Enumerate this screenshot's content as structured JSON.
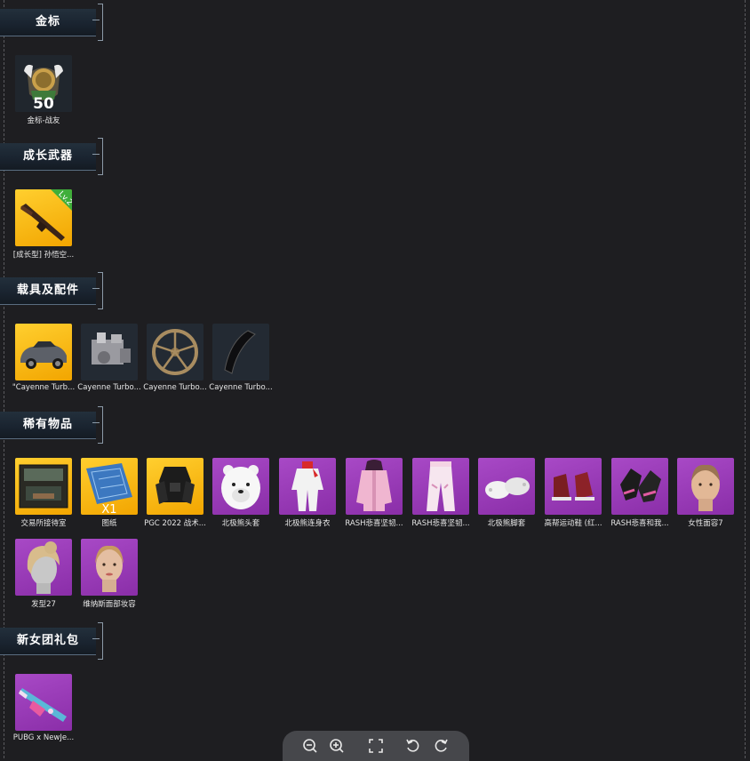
{
  "sections": {
    "gold": {
      "title": "金标"
    },
    "growth": {
      "title": "成长武器"
    },
    "vehicle": {
      "title": "载具及配件"
    },
    "rare": {
      "title": "稀有物品"
    },
    "pack": {
      "title": "新女团礼包"
    }
  },
  "items": {
    "gold_badge": {
      "label": "金标-战友",
      "number": "50"
    },
    "growth_gun": {
      "label": "[成长型] 孙悟空...",
      "level": "Lv.2"
    },
    "car": {
      "label": "\"Cayenne Turb..."
    },
    "engine": {
      "label": "Cayenne Turbo..."
    },
    "wheel": {
      "label": "Cayenne Turbo..."
    },
    "spoiler": {
      "label": "Cayenne Turbo..."
    },
    "room": {
      "label": "交易所接待室"
    },
    "blueprint": {
      "label": "图纸",
      "qty": "X1"
    },
    "pgc": {
      "label": "PGC 2022 战术..."
    },
    "bear_head": {
      "label": "北极熊头套"
    },
    "bear_suit": {
      "label": "北极熊连身衣"
    },
    "rash_hoodie": {
      "label": "RASH悲喜坚韧..."
    },
    "rash_pants": {
      "label": "RASH悲喜坚韧..."
    },
    "bear_feet": {
      "label": "北极熊脚套"
    },
    "sneakers": {
      "label": "高帮运动鞋 (红..."
    },
    "rash_gloves": {
      "label": "RASH悲喜和我..."
    },
    "face7": {
      "label": "女性面容7"
    },
    "hair27": {
      "label": "发型27"
    },
    "venus_makeup": {
      "label": "维纳斯面部妆容"
    },
    "pubg_newjeans": {
      "label": "PUBG x NewJe..."
    }
  },
  "toolbar": {
    "icons": [
      "zoom-out-icon",
      "zoom-in-icon",
      "fullscreen-icon",
      "rotate-left-icon",
      "rotate-right-icon"
    ]
  },
  "colors": {
    "gold_bg": "#f7b80f",
    "purple_bg": "#9b3dba",
    "dark_bg": "#232a33",
    "page_bg": "#1e1e21"
  }
}
